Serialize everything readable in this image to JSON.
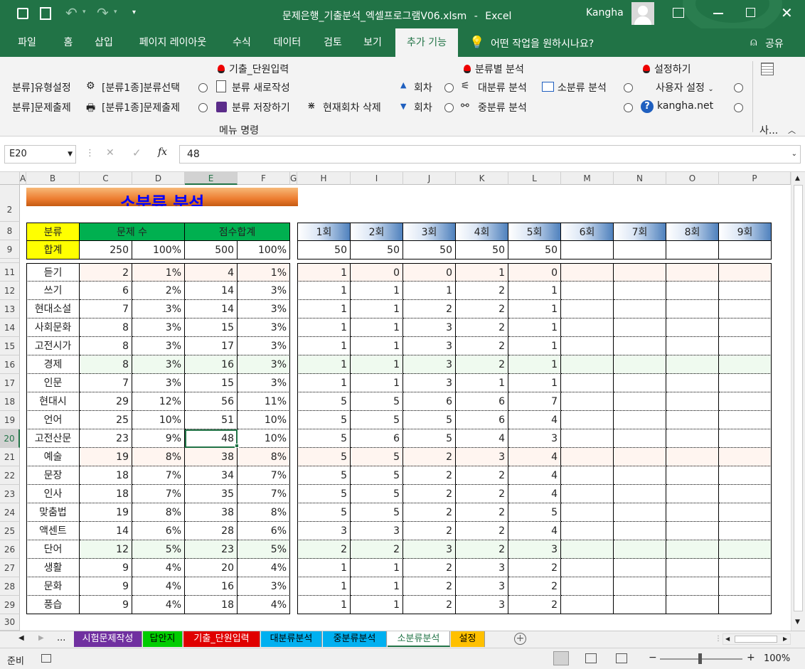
{
  "titlebar": {
    "filename": "문제은행_기출분석_엑셀프로그램V06.xlsm",
    "separator": "-",
    "app": "Excel",
    "user": "Kangha"
  },
  "tabs": [
    "파일",
    "홈",
    "삽입",
    "페이지 레이아웃",
    "수식",
    "데이터",
    "검토",
    "보기",
    "추가 기능"
  ],
  "tell_me": "어떤 작업을 원하시나요?",
  "share": "공유",
  "ribbon": {
    "left1": "분류]유형설정",
    "left2": "분류]문제출제",
    "sel1": "[분류1종]분류선택",
    "sel2": "[분류1종]문제출제",
    "gichul": "기출_단원입력",
    "new": "분류 새로작성",
    "save": "분류 저장하기",
    "del": "현재회차 삭제",
    "up": "회차",
    "down": "회차",
    "bycat": "분류별 분석",
    "big": "대분류 분석",
    "mid": "중분류 분석",
    "small": "소분류 분석",
    "settings": "설정하기",
    "usercfg": "사용자 설정",
    "site": "kangha.net",
    "group": "메뉴 명령",
    "more": "사..."
  },
  "formula": {
    "namebox": "E20",
    "value": "48"
  },
  "columns": [
    "A",
    "B",
    "C",
    "D",
    "E",
    "F",
    "G",
    "H",
    "I",
    "J",
    "K",
    "L",
    "M",
    "N",
    "O",
    "P"
  ],
  "rownums": [
    "2",
    "8",
    "9",
    "10",
    "11",
    "12",
    "13",
    "14",
    "15",
    "16",
    "17",
    "18",
    "19",
    "20",
    "21",
    "22",
    "23",
    "24",
    "25",
    "26",
    "27",
    "28",
    "29",
    "30"
  ],
  "sheet": {
    "title": "소분류 분석",
    "hdr_cat": "분류",
    "hdr_count": "문제 수",
    "hdr_score": "점수합계",
    "total_label": "합계",
    "total": [
      "250",
      "100%",
      "500",
      "100%"
    ],
    "rounds": [
      "1회",
      "2회",
      "3회",
      "4회",
      "5회",
      "6회",
      "7회",
      "8회",
      "9회"
    ],
    "round_totals": [
      "50",
      "50",
      "50",
      "50",
      "50",
      "",
      "",
      "",
      ""
    ],
    "rows": [
      {
        "name": "듣기",
        "v": [
          "2",
          "1%",
          "4",
          "1%"
        ],
        "r": [
          "1",
          "0",
          "0",
          "1",
          "0"
        ]
      },
      {
        "name": "쓰기",
        "v": [
          "6",
          "2%",
          "14",
          "3%"
        ],
        "r": [
          "1",
          "1",
          "1",
          "2",
          "1"
        ]
      },
      {
        "name": "현대소설",
        "v": [
          "7",
          "3%",
          "14",
          "3%"
        ],
        "r": [
          "1",
          "1",
          "2",
          "2",
          "1"
        ]
      },
      {
        "name": "사회문화",
        "v": [
          "8",
          "3%",
          "15",
          "3%"
        ],
        "r": [
          "1",
          "1",
          "3",
          "2",
          "1"
        ]
      },
      {
        "name": "고전시가",
        "v": [
          "8",
          "3%",
          "17",
          "3%"
        ],
        "r": [
          "1",
          "1",
          "3",
          "2",
          "1"
        ]
      },
      {
        "name": "경제",
        "v": [
          "8",
          "3%",
          "16",
          "3%"
        ],
        "r": [
          "1",
          "1",
          "3",
          "2",
          "1"
        ]
      },
      {
        "name": "인문",
        "v": [
          "7",
          "3%",
          "15",
          "3%"
        ],
        "r": [
          "1",
          "1",
          "3",
          "1",
          "1"
        ]
      },
      {
        "name": "현대시",
        "v": [
          "29",
          "12%",
          "56",
          "11%"
        ],
        "r": [
          "5",
          "5",
          "6",
          "6",
          "7"
        ]
      },
      {
        "name": "언어",
        "v": [
          "25",
          "10%",
          "51",
          "10%"
        ],
        "r": [
          "5",
          "5",
          "5",
          "6",
          "4"
        ]
      },
      {
        "name": "고전산문",
        "v": [
          "23",
          "9%",
          "48",
          "10%"
        ],
        "r": [
          "5",
          "6",
          "5",
          "4",
          "3"
        ]
      },
      {
        "name": "예술",
        "v": [
          "19",
          "8%",
          "38",
          "8%"
        ],
        "r": [
          "5",
          "5",
          "2",
          "3",
          "4"
        ]
      },
      {
        "name": "문장",
        "v": [
          "18",
          "7%",
          "34",
          "7%"
        ],
        "r": [
          "5",
          "5",
          "2",
          "2",
          "4"
        ]
      },
      {
        "name": "인사",
        "v": [
          "18",
          "7%",
          "35",
          "7%"
        ],
        "r": [
          "5",
          "5",
          "2",
          "2",
          "4"
        ]
      },
      {
        "name": "맞춤법",
        "v": [
          "19",
          "8%",
          "38",
          "8%"
        ],
        "r": [
          "5",
          "5",
          "2",
          "2",
          "5"
        ]
      },
      {
        "name": "액센트",
        "v": [
          "14",
          "6%",
          "28",
          "6%"
        ],
        "r": [
          "3",
          "3",
          "2",
          "2",
          "4"
        ]
      },
      {
        "name": "단어",
        "v": [
          "12",
          "5%",
          "23",
          "5%"
        ],
        "r": [
          "2",
          "2",
          "3",
          "2",
          "3"
        ]
      },
      {
        "name": "생활",
        "v": [
          "9",
          "4%",
          "20",
          "4%"
        ],
        "r": [
          "1",
          "1",
          "2",
          "3",
          "2"
        ]
      },
      {
        "name": "문화",
        "v": [
          "9",
          "4%",
          "16",
          "3%"
        ],
        "r": [
          "1",
          "1",
          "2",
          "3",
          "2"
        ]
      },
      {
        "name": "풍습",
        "v": [
          "9",
          "4%",
          "18",
          "4%"
        ],
        "r": [
          "1",
          "1",
          "2",
          "3",
          "2"
        ]
      }
    ]
  },
  "sheet_tabs": [
    {
      "label": "시험문제작성",
      "color": "#7030a0",
      "fg": "#ffffff"
    },
    {
      "label": "답안지",
      "color": "#00cc00",
      "fg": "#000000"
    },
    {
      "label": "기출_단원입력",
      "color": "#e00000",
      "fg": "#ffffff"
    },
    {
      "label": "대분류분석",
      "color": "#00b0f0",
      "fg": "#000000"
    },
    {
      "label": "중분류분석",
      "color": "#00b0f0",
      "fg": "#000000"
    },
    {
      "label": "소분류분석",
      "color": "#ffffff",
      "fg": "#217346"
    },
    {
      "label": "설정",
      "color": "#ffc000",
      "fg": "#000000"
    }
  ],
  "status": {
    "ready": "준비",
    "zoom": "100%"
  },
  "colors": {
    "excel_green": "#217346",
    "title_orange": "#ed7d31",
    "header_yellow": "#ffff00",
    "header_green": "#00b050",
    "title_blue": "#0000ff"
  }
}
